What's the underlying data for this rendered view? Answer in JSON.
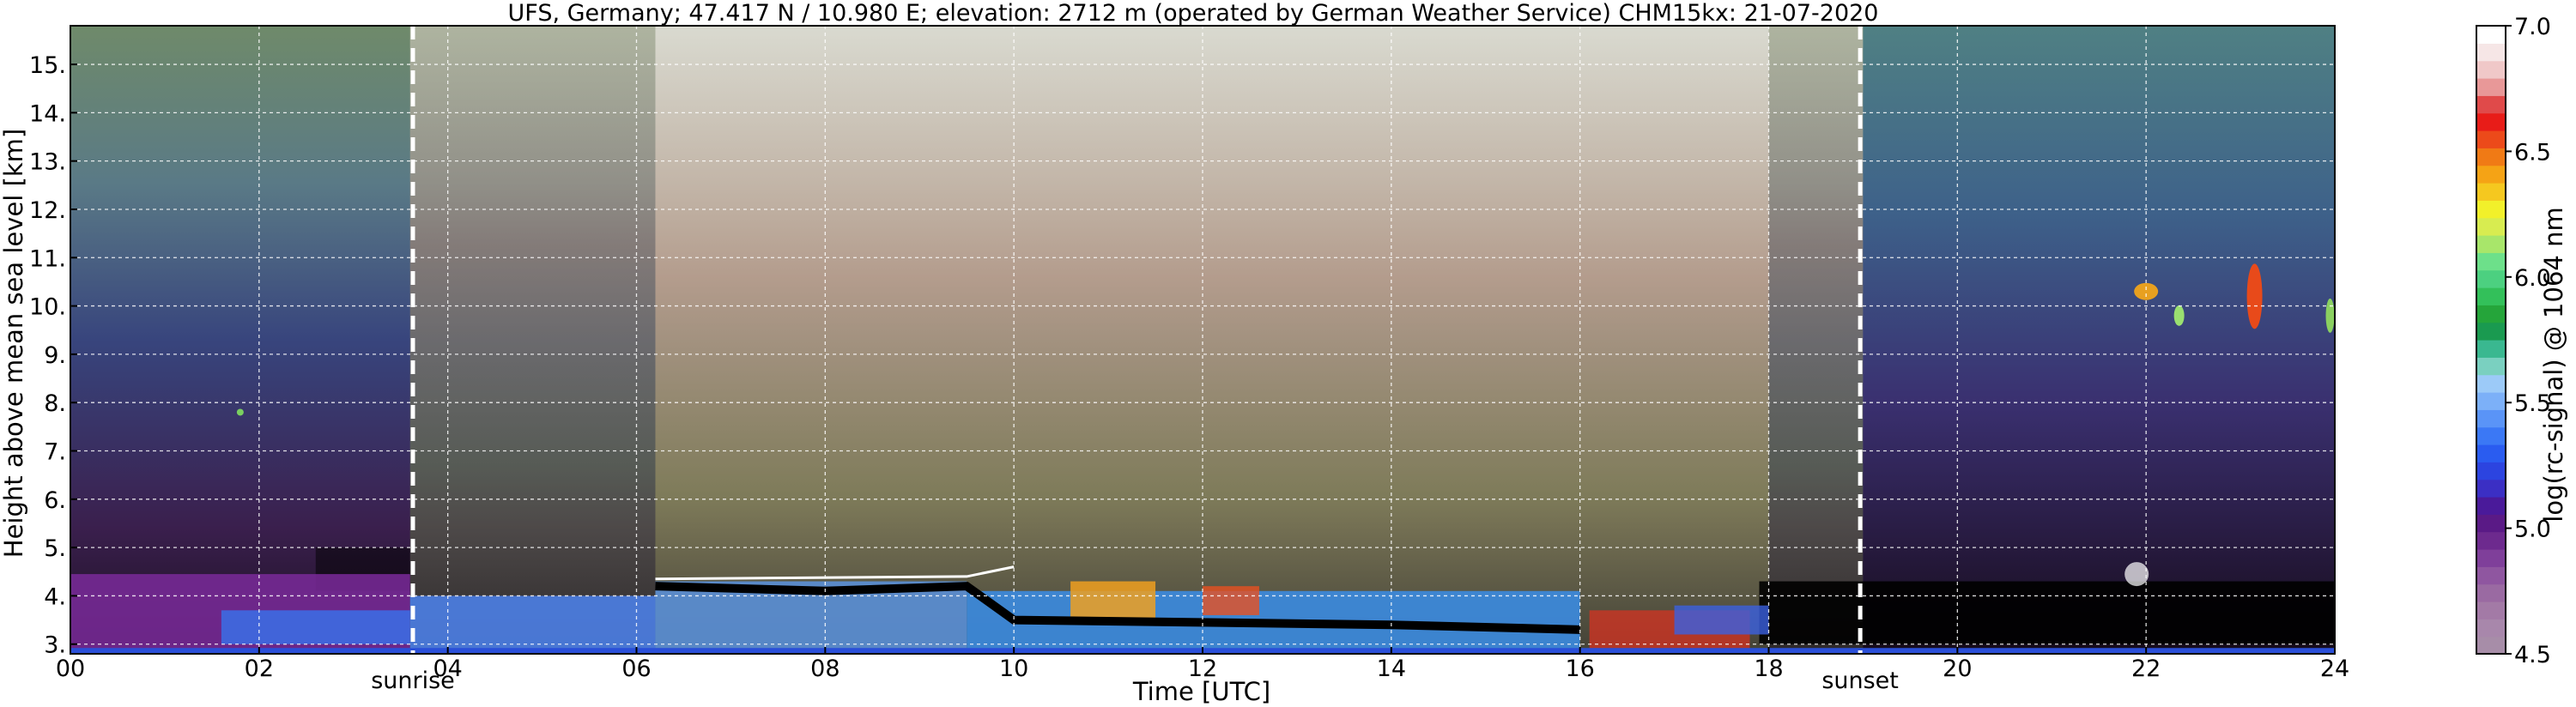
{
  "chart_data": {
    "type": "heatmap",
    "title": "UFS, Germany; 47.417 N / 10.980 E; elevation: 2712 m  (operated by German Weather Service)    CHM15kx: 21-07-2020",
    "xlabel": "Time [UTC]",
    "ylabel": "Height above mean sea level [km]",
    "xlim": [
      0,
      24
    ],
    "ylim": [
      2.8,
      15.8
    ],
    "x_ticks": [
      0,
      2,
      4,
      6,
      8,
      10,
      12,
      14,
      16,
      18,
      20,
      22,
      24
    ],
    "x_tick_labels": [
      "00",
      "02",
      "04",
      "06",
      "08",
      "10",
      "12",
      "14",
      "16",
      "18",
      "20",
      "22",
      "24"
    ],
    "y_ticks": [
      3,
      4,
      5,
      6,
      7,
      8,
      9,
      10,
      11,
      12,
      13,
      14,
      15
    ],
    "y_tick_labels": [
      "3.",
      "4.",
      "5.",
      "6.",
      "7.",
      "8.",
      "9.",
      "10.",
      "11.",
      "12.",
      "13.",
      "14.",
      "15."
    ],
    "grid": true,
    "markers": [
      {
        "label": "sunrise",
        "x": 3.63
      },
      {
        "label": "sunset",
        "x": 18.97
      }
    ],
    "colorbar": {
      "label": "log(rc-signal) @ 1064 nm",
      "range": [
        4.5,
        7.0
      ],
      "ticks": [
        4.5,
        5.0,
        5.5,
        6.0,
        6.5,
        7.0
      ],
      "tick_labels": [
        "4.5",
        "5.0",
        "5.5",
        "6.0",
        "6.5",
        "7.0"
      ]
    }
  }
}
